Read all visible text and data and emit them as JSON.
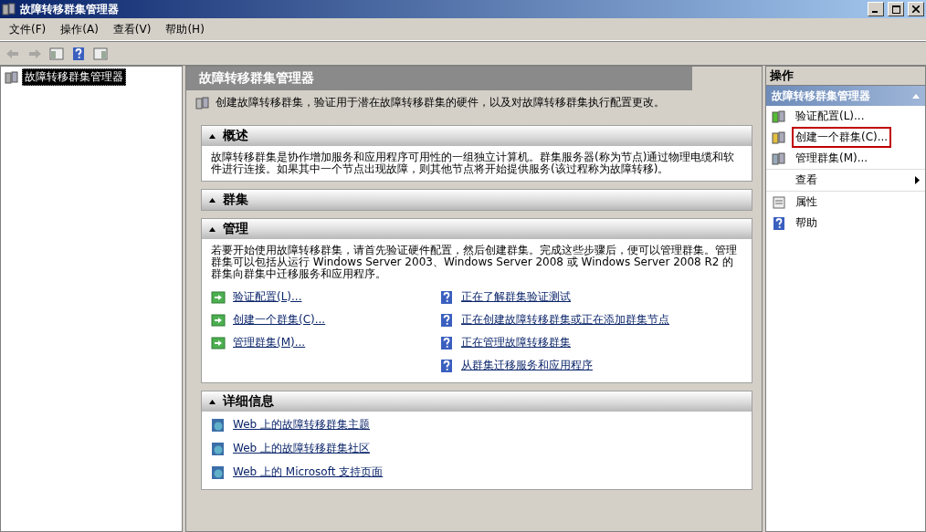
{
  "window": {
    "title": "故障转移群集管理器"
  },
  "menu": [
    "文件(F)",
    "操作(A)",
    "查看(V)",
    "帮助(H)"
  ],
  "toolbar": [
    {
      "kind": "back",
      "disabled": true
    },
    {
      "kind": "forward",
      "disabled": true
    },
    {
      "kind": "pane",
      "disabled": false
    },
    {
      "kind": "help",
      "disabled": false
    },
    {
      "kind": "pane2",
      "disabled": false
    }
  ],
  "tree": {
    "items": [
      {
        "label": "故障转移群集管理器",
        "selected": true
      }
    ]
  },
  "main": {
    "title": "故障转移群集管理器",
    "intro": "创建故障转移群集，验证用于潜在故障转移群集的硬件，以及对故障转移群集执行配置更改。",
    "sections": [
      {
        "title": "概述",
        "text": "故障转移群集是协作增加服务和应用程序可用性的一组独立计算机。群集服务器(称为节点)通过物理电缆和软件进行连接。如果其中一个节点出现故障，则其他节点将开始提供服务(该过程称为故障转移)。"
      },
      {
        "title": "群集"
      },
      {
        "title": "管理",
        "text": "若要开始使用故障转移群集，请首先验证硬件配置，然后创建群集。完成这些步骤后，便可以管理群集。管理群集可以包括从运行 Windows Server 2003、Windows Server 2008 或 Windows Server 2008 R2 的群集向群集中迁移服务和应用程序。",
        "links": [
          {
            "label": "验证配置(L)...",
            "kind": "action"
          },
          {
            "label": "正在了解群集验证测试",
            "kind": "help"
          },
          {
            "label": "创建一个群集(C)...",
            "kind": "action"
          },
          {
            "label": "正在创建故障转移群集或正在添加群集节点",
            "kind": "help"
          },
          {
            "label": "管理群集(M)...",
            "kind": "action"
          },
          {
            "label": "正在管理故障转移群集",
            "kind": "help"
          },
          {
            "kind": "none"
          },
          {
            "label": "从群集迁移服务和应用程序",
            "kind": "help"
          }
        ]
      },
      {
        "title": "详细信息",
        "links": [
          {
            "label": "Web 上的故障转移群集主题",
            "kind": "web"
          },
          {
            "label": "Web 上的故障转移群集社区",
            "kind": "web"
          },
          {
            "label": "Web 上的 Microsoft 支持页面",
            "kind": "web"
          }
        ]
      }
    ]
  },
  "actions": {
    "title": "操作",
    "group": "故障转移群集管理器",
    "items": [
      {
        "label": "验证配置(L)...",
        "kind": "validate",
        "highlighted": false
      },
      {
        "label": "创建一个群集(C)...",
        "kind": "create",
        "highlighted": true
      },
      {
        "label": "管理群集(M)...",
        "kind": "manage",
        "highlighted": false
      },
      {
        "label": "查看",
        "kind": "submenu",
        "highlighted": false
      },
      {
        "label": "属性",
        "kind": "properties",
        "highlighted": false
      },
      {
        "label": "帮助",
        "kind": "help",
        "highlighted": false
      }
    ]
  }
}
